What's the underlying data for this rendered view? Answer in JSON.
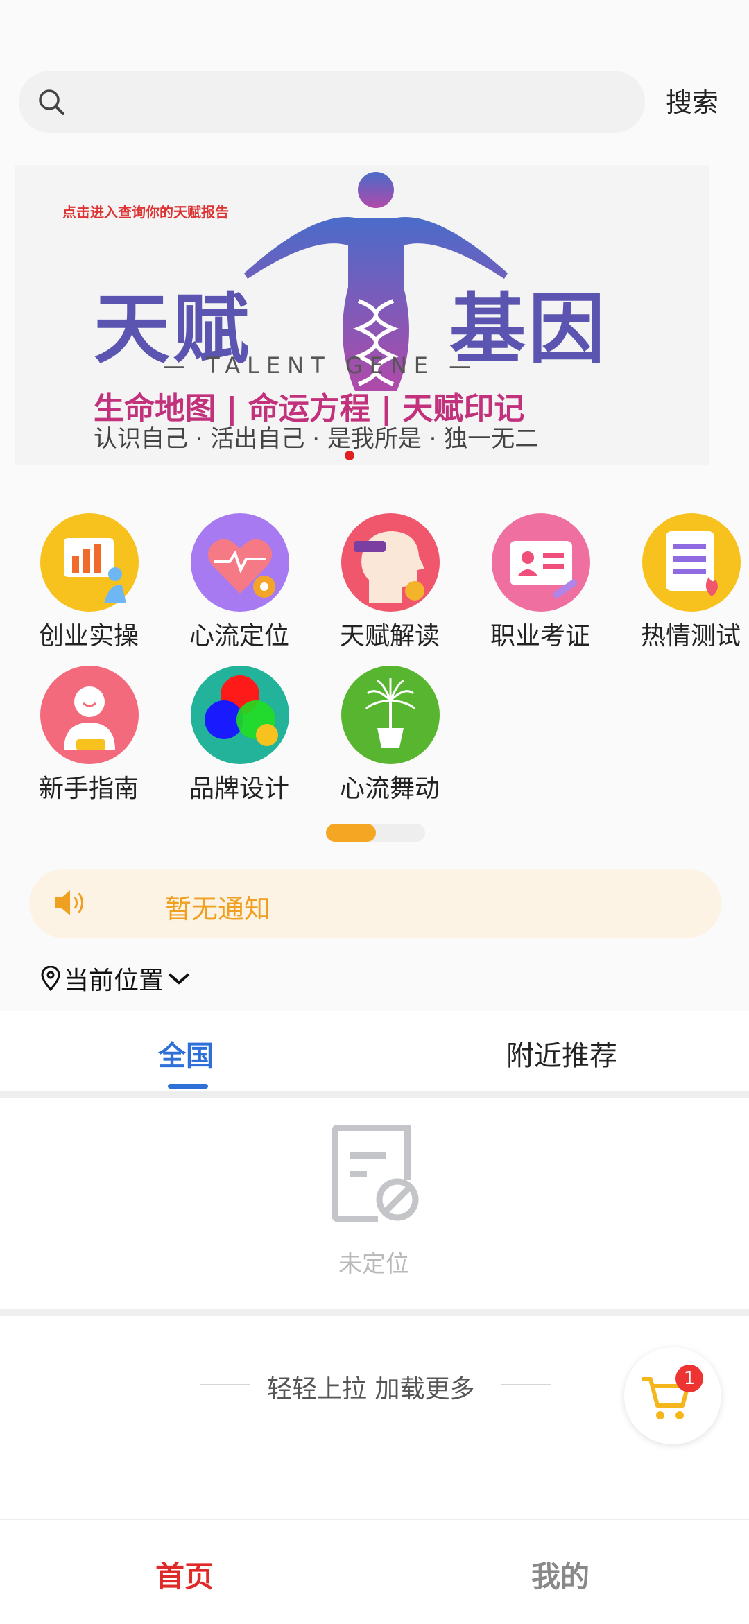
{
  "search": {
    "button_label": "搜索",
    "placeholder": ""
  },
  "banner": {
    "small_text": "点击进入查询你的天赋报告",
    "logo_left": "天赋",
    "logo_right": "基因",
    "english": "— TALENT GENE —",
    "line1": "生命地图 | 命运方程 | 天赋印记",
    "line2": "认识自己 · 活出自己 · 是我所是 · 独一无二",
    "indicator_active": 1,
    "indicator_total": 1
  },
  "grid": {
    "items": [
      {
        "label": "创业实操",
        "icon": "business-chart-icon",
        "color": "#f7c21d"
      },
      {
        "label": "心流定位",
        "icon": "heart-pulse-icon",
        "color": "#a77af2"
      },
      {
        "label": "天赋解读",
        "icon": "head-key-icon",
        "color": "#f0566c"
      },
      {
        "label": "职业考证",
        "icon": "id-card-icon",
        "color": "#ef6fa0"
      },
      {
        "label": "热情测试",
        "icon": "document-flame-icon",
        "color": "#f7c21d"
      },
      {
        "label": "新手指南",
        "icon": "person-guide-icon",
        "color": "#f26a7c"
      },
      {
        "label": "品牌设计",
        "icon": "color-circles-icon",
        "color": "#22b39a"
      },
      {
        "label": "心流舞动",
        "icon": "plant-pot-icon",
        "color": "#57b52f"
      }
    ],
    "pager_progress": 0.5
  },
  "notice": {
    "text": "暂无通知",
    "icon": "speaker-icon"
  },
  "location": {
    "label": "当前位置",
    "icon": "location-pin-icon",
    "chevron": "chevron-down-icon"
  },
  "tabs": [
    {
      "label": "全国",
      "active": true
    },
    {
      "label": "附近推荐",
      "active": false
    }
  ],
  "empty_state": {
    "text": "未定位",
    "icon": "document-blocked-icon"
  },
  "load_more": {
    "text": "轻轻上拉 加载更多"
  },
  "cart": {
    "badge": "1",
    "icon": "cart-icon"
  },
  "bottom_nav": [
    {
      "label": "首页",
      "active": true
    },
    {
      "label": "我的",
      "active": false
    }
  ],
  "colors": {
    "accent_blue": "#2f6fd8",
    "accent_red": "#e02a2a",
    "notice_orange": "#f0a020"
  }
}
